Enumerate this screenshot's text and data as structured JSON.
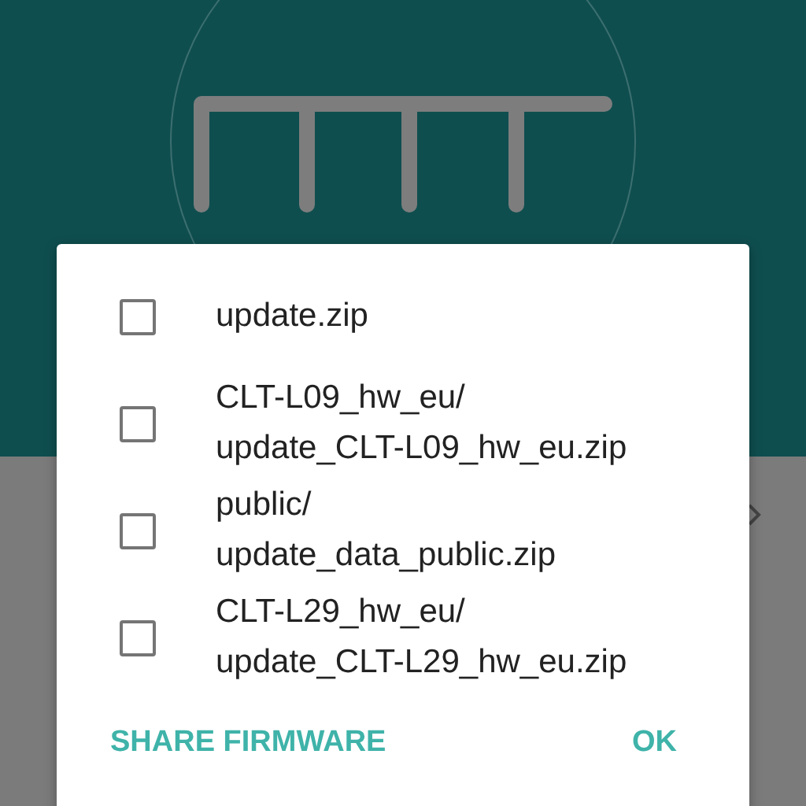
{
  "dialog": {
    "options": [
      {
        "label": "update.zip",
        "checked": false
      },
      {
        "label": "CLT-L09_hw_eu/\nupdate_CLT-L09_hw_eu.zip",
        "checked": false
      },
      {
        "label": "public/\nupdate_data_public.zip",
        "checked": false
      },
      {
        "label": "CLT-L29_hw_eu/\nupdate_CLT-L29_hw_eu.zip",
        "checked": false
      }
    ],
    "buttons": [
      "SHARE FIRMWARE",
      "OK"
    ]
  }
}
